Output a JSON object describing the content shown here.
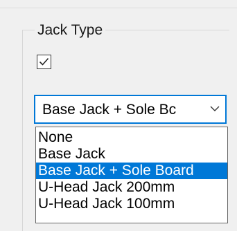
{
  "jack_type": {
    "title": "Jack Type",
    "checkbox_checked": true,
    "combo_value": "Base Jack + Sole Bc",
    "options": [
      "None",
      "Base Jack",
      "Base Jack + Sole Board",
      "U-Head Jack 200mm",
      "U-Head Jack 100mm"
    ],
    "selected_option": "Base Jack + Sole Board"
  },
  "colors": {
    "accent": "#0078d7",
    "background": "#f0f0f0"
  },
  "icons": {
    "checkbox": "checkmark-icon",
    "combo_arrow": "chevron-down-icon"
  }
}
